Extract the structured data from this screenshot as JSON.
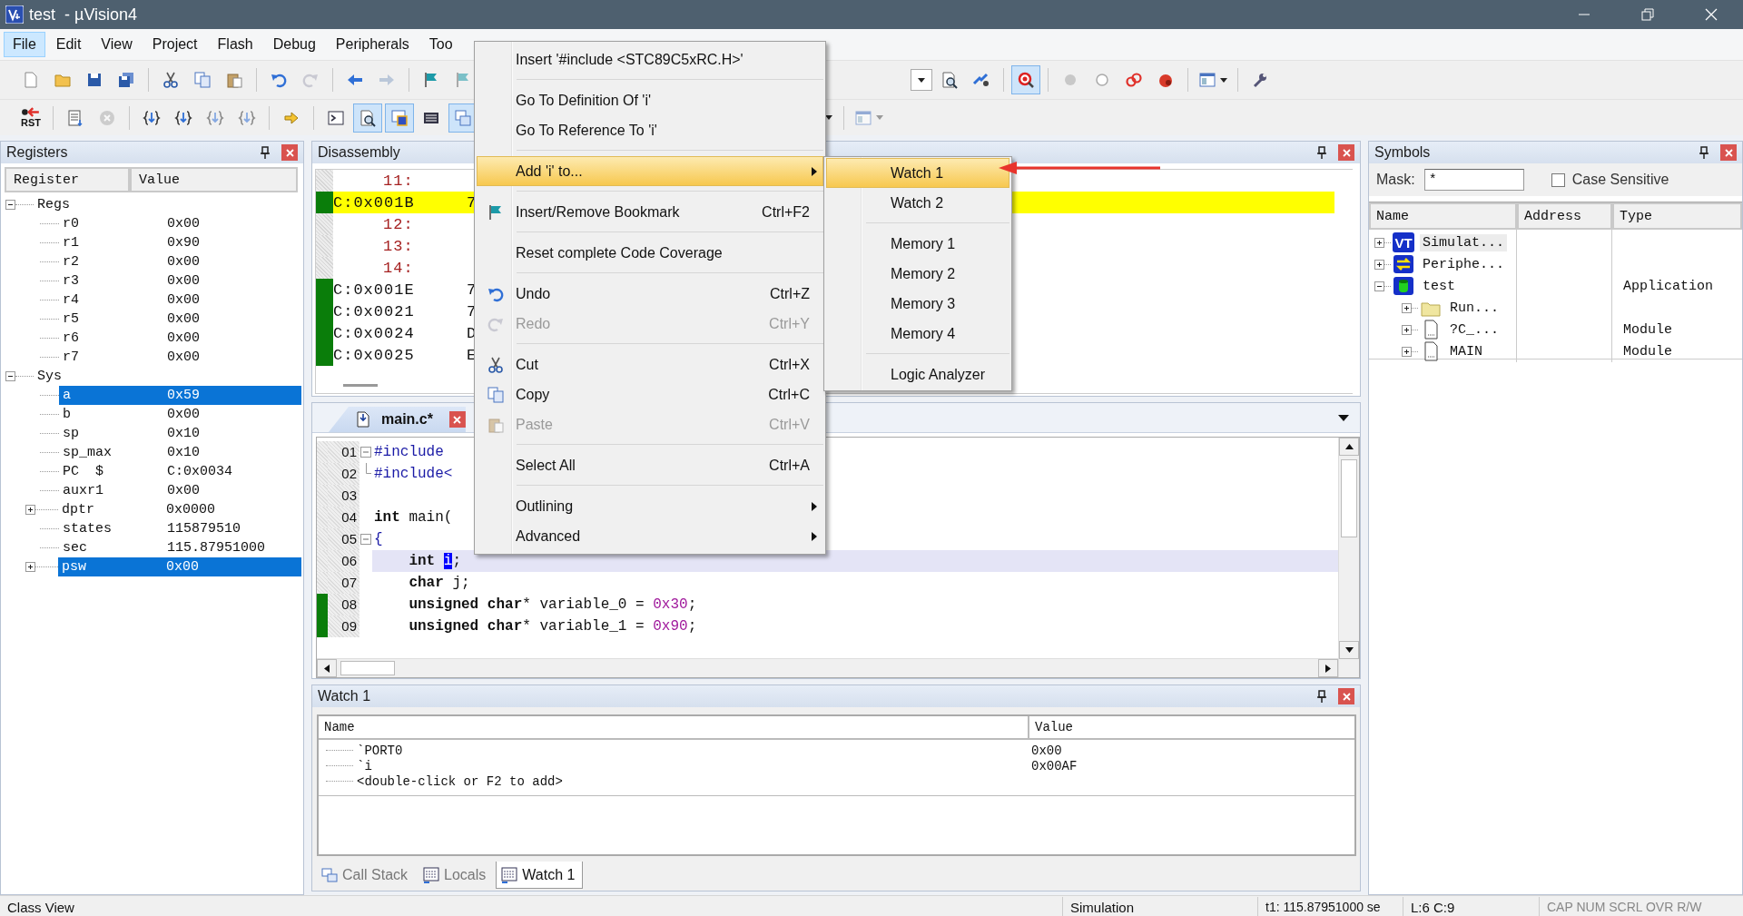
{
  "window": {
    "title": "test  - µVision4"
  },
  "menu_bar": [
    {
      "label": "File",
      "selected": true
    },
    {
      "label": "Edit",
      "selected": false
    },
    {
      "label": "View",
      "selected": false
    },
    {
      "label": "Project",
      "selected": false
    },
    {
      "label": "Flash",
      "selected": false
    },
    {
      "label": "Debug",
      "selected": false
    },
    {
      "label": "Peripherals",
      "selected": false
    },
    {
      "label": "Too",
      "selected": false
    }
  ],
  "toolbars": [
    {
      "left": [
        {
          "kind": "button",
          "pressed": false,
          "disabled": false
        },
        {
          "kind": "button",
          "pressed": false,
          "disabled": false
        },
        {
          "kind": "button",
          "pressed": false,
          "disabled": false
        },
        {
          "kind": "button",
          "pressed": false,
          "disabled": false
        },
        {
          "kind": "separator"
        },
        {
          "kind": "button",
          "pressed": false,
          "disabled": false
        },
        {
          "kind": "button",
          "pressed": false,
          "disabled": false
        },
        {
          "kind": "button",
          "pressed": false,
          "disabled": false
        },
        {
          "kind": "separator"
        },
        {
          "kind": "button",
          "pressed": false,
          "disabled": false
        },
        {
          "kind": "button",
          "pressed": false,
          "disabled": true
        },
        {
          "kind": "separator"
        },
        {
          "kind": "button",
          "pressed": false,
          "disabled": false
        },
        {
          "kind": "button",
          "pressed": false,
          "disabled": true
        },
        {
          "kind": "separator"
        },
        {
          "kind": "button",
          "pressed": false,
          "disabled": false
        },
        {
          "kind": "button",
          "pressed": false,
          "disabled": true
        }
      ],
      "right": [
        {
          "kind": "combo"
        },
        {
          "kind": "button",
          "pressed": false,
          "disabled": false
        },
        {
          "kind": "button",
          "pressed": false,
          "disabled": false
        },
        {
          "kind": "separator"
        },
        {
          "kind": "button",
          "pressed": true,
          "disabled": false
        },
        {
          "kind": "separator"
        },
        {
          "kind": "button",
          "pressed": false,
          "disabled": true
        },
        {
          "kind": "button",
          "pressed": false,
          "disabled": false
        },
        {
          "kind": "button",
          "pressed": false,
          "disabled": false
        },
        {
          "kind": "button",
          "pressed": false,
          "disabled": false
        },
        {
          "kind": "separator"
        },
        {
          "kind": "split",
          "pressed": false,
          "disabled": false
        },
        {
          "kind": "separator"
        },
        {
          "kind": "button",
          "pressed": false,
          "disabled": false
        }
      ]
    },
    {
      "left": [
        {
          "kind": "button",
          "label": "RST",
          "pressed": false,
          "disabled": false
        },
        {
          "kind": "separator"
        },
        {
          "kind": "button",
          "pressed": false,
          "disabled": false
        },
        {
          "kind": "button",
          "pressed": false,
          "disabled": true
        },
        {
          "kind": "separator"
        },
        {
          "kind": "button",
          "pressed": false,
          "disabled": false
        },
        {
          "kind": "button",
          "pressed": false,
          "disabled": false
        },
        {
          "kind": "button",
          "pressed": false,
          "disabled": true
        },
        {
          "kind": "button",
          "pressed": false,
          "disabled": true
        },
        {
          "kind": "separator"
        },
        {
          "kind": "button",
          "pressed": false,
          "disabled": false
        },
        {
          "kind": "separator"
        },
        {
          "kind": "button",
          "pressed": false,
          "disabled": false
        },
        {
          "kind": "button",
          "pressed": true,
          "disabled": false
        },
        {
          "kind": "button",
          "pressed": true,
          "disabled": false
        },
        {
          "kind": "button",
          "pressed": false,
          "disabled": false
        },
        {
          "kind": "button",
          "pressed": true,
          "disabled": false
        }
      ],
      "right": [
        {
          "kind": "dropdown"
        },
        {
          "kind": "separator"
        },
        {
          "kind": "split",
          "pressed": false,
          "disabled": true
        }
      ]
    }
  ],
  "registers": {
    "title": "Registers",
    "columns": [
      "Register",
      "Value"
    ],
    "tree": [
      {
        "name": "Regs",
        "expanded": true,
        "selected": false,
        "children": [
          {
            "name": "r0",
            "value": "0x00",
            "selected": false
          },
          {
            "name": "r1",
            "value": "0x90",
            "selected": false
          },
          {
            "name": "r2",
            "value": "0x00",
            "selected": false
          },
          {
            "name": "r3",
            "value": "0x00",
            "selected": false
          },
          {
            "name": "r4",
            "value": "0x00",
            "selected": false
          },
          {
            "name": "r5",
            "value": "0x00",
            "selected": false
          },
          {
            "name": "r6",
            "value": "0x00",
            "selected": false
          },
          {
            "name": "r7",
            "value": "0x00",
            "selected": false
          }
        ]
      },
      {
        "name": "Sys",
        "expanded": true,
        "selected": false,
        "children": [
          {
            "name": "a",
            "value": "0x59",
            "selected": true
          },
          {
            "name": "b",
            "value": "0x00",
            "selected": false
          },
          {
            "name": "sp",
            "value": "0x10",
            "selected": false
          },
          {
            "name": "sp_max",
            "value": "0x10",
            "selected": false
          },
          {
            "name": "PC  $",
            "value": "C:0x0034",
            "selected": false
          },
          {
            "name": "auxr1",
            "value": "0x00",
            "selected": false
          },
          {
            "name": "dptr",
            "value": "0x0000",
            "expanded": false,
            "selected": false
          },
          {
            "name": "states",
            "value": "115879510",
            "selected": false
          },
          {
            "name": "sec",
            "value": "115.87951000",
            "selected": false
          },
          {
            "name": "psw",
            "value": "0x00",
            "expanded": false,
            "selected": true
          }
        ]
      }
    ]
  },
  "disassembly": {
    "title": "Disassembly",
    "lines": [
      {
        "kind": "source",
        "text": "11:",
        "executed": false,
        "current": false
      },
      {
        "kind": "code",
        "address": "C:0x001B",
        "bytes": "7",
        "executed": true,
        "current": true
      },
      {
        "kind": "source",
        "text": "12:",
        "executed": false,
        "current": false
      },
      {
        "kind": "source",
        "text": "13:",
        "executed": false,
        "current": false
      },
      {
        "kind": "source",
        "text": "14:",
        "executed": false,
        "current": false
      },
      {
        "kind": "code",
        "address": "C:0x001E",
        "bytes": "7",
        "executed": true,
        "current": false
      },
      {
        "kind": "code",
        "address": "C:0x0021",
        "bytes": "7",
        "executed": true,
        "current": false
      },
      {
        "kind": "code",
        "address": "C:0x0024",
        "bytes": "D",
        "executed": true,
        "current": false
      },
      {
        "kind": "code",
        "address": "C:0x0025",
        "bytes": "E",
        "executed": true,
        "current": false
      }
    ]
  },
  "editor": {
    "tabs": [
      {
        "label": "main.c*",
        "selected": true
      }
    ],
    "lines": [
      {
        "number": "01",
        "fold_start": true,
        "fold_end": false,
        "executed": false,
        "current": false,
        "tokens": [
          {
            "kind": "preproc",
            "text": "#include"
          }
        ]
      },
      {
        "number": "02",
        "fold_start": false,
        "fold_end": true,
        "executed": false,
        "current": false,
        "tokens": [
          {
            "kind": "preproc",
            "text": "#include<"
          }
        ]
      },
      {
        "number": "03",
        "fold_start": false,
        "fold_end": false,
        "executed": false,
        "current": false
      },
      {
        "number": "04",
        "fold_start": false,
        "fold_end": false,
        "executed": false,
        "current": false,
        "tokens": [
          {
            "kind": "keyword",
            "text": "int"
          },
          {
            "kind": "plain",
            "text": " main("
          }
        ]
      },
      {
        "number": "05",
        "fold_start": true,
        "fold_end": false,
        "executed": false,
        "current": false,
        "tokens": [
          {
            "kind": "brace",
            "text": "{"
          }
        ]
      },
      {
        "number": "06",
        "fold_start": false,
        "fold_end": false,
        "executed": false,
        "current": true,
        "tokens": [
          {
            "kind": "keyword",
            "text": "    int "
          },
          {
            "kind": "selection",
            "text": "i"
          },
          {
            "kind": "plain",
            "text": ";"
          }
        ]
      },
      {
        "number": "07",
        "fold_start": false,
        "fold_end": false,
        "executed": false,
        "current": false,
        "tokens": [
          {
            "kind": "keyword",
            "text": "    char"
          },
          {
            "kind": "plain",
            "text": " j;"
          }
        ]
      },
      {
        "number": "08",
        "fold_start": false,
        "fold_end": false,
        "executed": true,
        "current": false,
        "tokens": [
          {
            "kind": "keyword",
            "text": "    unsigned char"
          },
          {
            "kind": "plain",
            "text": "* variable_0 = "
          },
          {
            "kind": "number",
            "text": "0x30"
          },
          {
            "kind": "plain",
            "text": ";"
          }
        ]
      },
      {
        "number": "09",
        "fold_start": false,
        "fold_end": false,
        "executed": true,
        "current": false,
        "tokens": [
          {
            "kind": "keyword",
            "text": "    unsigned char"
          },
          {
            "kind": "plain",
            "text": "* variable_1 = "
          },
          {
            "kind": "number",
            "text": "0x90"
          },
          {
            "kind": "plain",
            "text": ";"
          }
        ]
      }
    ]
  },
  "watch": {
    "title": "Watch 1",
    "columns": [
      "Name",
      "Value"
    ],
    "rows": [
      {
        "name": "`PORT0",
        "value": "0x00"
      },
      {
        "name": "`i",
        "value": "0x00AF"
      },
      {
        "name": "<double-click or F2 to add>"
      }
    ],
    "tabs": [
      {
        "label": "Call Stack",
        "selected": false
      },
      {
        "label": "Locals",
        "selected": false
      },
      {
        "label": "Watch 1",
        "selected": true
      }
    ]
  },
  "symbols": {
    "title": "Symbols",
    "mask_label": "Mask:",
    "mask": "*",
    "case_sensitive": {
      "label": "Case Sensitive",
      "checked": false
    },
    "columns": [
      "Name",
      "Address",
      "Type"
    ],
    "tree": [
      {
        "kind": "simulator",
        "badge": "VT",
        "name": "Simulat...",
        "expanded": false,
        "selected": true
      },
      {
        "kind": "peripherals",
        "name": "Periphe...",
        "expanded": false,
        "selected": false
      },
      {
        "kind": "application",
        "name": "test",
        "type": "Application",
        "expanded": true,
        "selected": false,
        "children": [
          {
            "kind": "folder",
            "name": "Run...",
            "expanded": false,
            "selected": false
          },
          {
            "kind": "module",
            "name": "?C_...",
            "type": "Module",
            "expanded": false,
            "selected": false
          },
          {
            "kind": "module",
            "name": "MAIN",
            "type": "Module",
            "expanded": false,
            "selected": false
          }
        ]
      }
    ]
  },
  "context_menu": {
    "items": [
      {
        "kind": "item",
        "label": "Insert '#include <STC89C5xRC.H>'",
        "disabled": false,
        "selected": false
      },
      {
        "kind": "separator"
      },
      {
        "kind": "item",
        "label": "Go To Definition Of 'i'",
        "disabled": false,
        "selected": false
      },
      {
        "kind": "item",
        "label": "Go To Reference To 'i'",
        "disabled": false,
        "selected": false
      },
      {
        "kind": "separator"
      },
      {
        "kind": "submenu",
        "label": "Add 'i' to...",
        "disabled": false,
        "selected": true
      },
      {
        "kind": "separator"
      },
      {
        "kind": "item",
        "label": "Insert/Remove Bookmark",
        "shortcut": "Ctrl+F2",
        "disabled": false,
        "selected": false
      },
      {
        "kind": "separator"
      },
      {
        "kind": "item",
        "label": "Reset complete Code Coverage",
        "disabled": false,
        "selected": false
      },
      {
        "kind": "separator"
      },
      {
        "kind": "item",
        "label": "Undo",
        "shortcut": "Ctrl+Z",
        "disabled": false,
        "selected": false
      },
      {
        "kind": "item",
        "label": "Redo",
        "shortcut": "Ctrl+Y",
        "disabled": true,
        "selected": false
      },
      {
        "kind": "separator"
      },
      {
        "kind": "item",
        "label": "Cut",
        "shortcut": "Ctrl+X",
        "disabled": false,
        "selected": false
      },
      {
        "kind": "item",
        "label": "Copy",
        "shortcut": "Ctrl+C",
        "disabled": false,
        "selected": false
      },
      {
        "kind": "item",
        "label": "Paste",
        "shortcut": "Ctrl+V",
        "disabled": true,
        "selected": false
      },
      {
        "kind": "separator"
      },
      {
        "kind": "item",
        "label": "Select All",
        "shortcut": "Ctrl+A",
        "disabled": false,
        "selected": false
      },
      {
        "kind": "separator"
      },
      {
        "kind": "submenu",
        "label": "Outlining",
        "disabled": false,
        "selected": false
      },
      {
        "kind": "submenu",
        "label": "Advanced",
        "disabled": false,
        "selected": false
      }
    ]
  },
  "submenu": {
    "items": [
      {
        "kind": "item",
        "label": "Watch 1",
        "selected": true
      },
      {
        "kind": "item",
        "label": "Watch 2",
        "selected": false
      },
      {
        "kind": "separator"
      },
      {
        "kind": "item",
        "label": "Memory 1",
        "selected": false
      },
      {
        "kind": "item",
        "label": "Memory 2",
        "selected": false
      },
      {
        "kind": "item",
        "label": "Memory 3",
        "selected": false
      },
      {
        "kind": "item",
        "label": "Memory 4",
        "selected": false
      },
      {
        "kind": "separator"
      },
      {
        "kind": "item",
        "label": "Logic Analyzer",
        "selected": false
      }
    ]
  },
  "status_bar": {
    "left": "Class View",
    "mode": "Simulation",
    "time": "t1: 115.87951000 se",
    "position": "L:6 C:9",
    "indicators": "CAP NUM SCRL OVR R/W"
  }
}
